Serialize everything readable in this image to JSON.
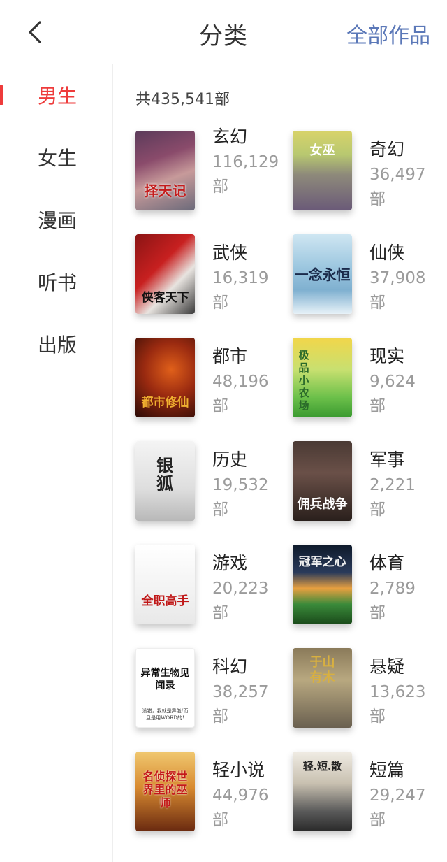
{
  "header": {
    "back_icon": "chevron-left-icon",
    "title": "分类",
    "all_works": "全部作品"
  },
  "sidebar": {
    "accent_color": "#ee3b3b",
    "items": [
      {
        "label": "男生",
        "active": true
      },
      {
        "label": "女生",
        "active": false
      },
      {
        "label": "漫画",
        "active": false
      },
      {
        "label": "听书",
        "active": false
      },
      {
        "label": "出版",
        "active": false
      }
    ]
  },
  "total": "共435,541部",
  "categories": [
    {
      "name": "玄幻",
      "count": "116,129",
      "unit": "部",
      "cover_title": "择天记"
    },
    {
      "name": "奇幻",
      "count": "36,497",
      "unit": "部",
      "cover_title": "女巫"
    },
    {
      "name": "武侠",
      "count": "16,319",
      "unit": "部",
      "cover_title": "侠客天下"
    },
    {
      "name": "仙侠",
      "count": "37,908",
      "unit": "部",
      "cover_title": "一念永恒"
    },
    {
      "name": "都市",
      "count": "48,196",
      "unit": "部",
      "cover_title": "都市修仙"
    },
    {
      "name": "现实",
      "count": "9,624",
      "unit": "部",
      "cover_title": "极品小农场"
    },
    {
      "name": "历史",
      "count": "19,532",
      "unit": "部",
      "cover_title": "银狐"
    },
    {
      "name": "军事",
      "count": "2,221",
      "unit": "部",
      "cover_title": "佣兵战争"
    },
    {
      "name": "游戏",
      "count": "20,223",
      "unit": "部",
      "cover_title": "全职高手"
    },
    {
      "name": "体育",
      "count": "2,789",
      "unit": "部",
      "cover_title": "冠军之心"
    },
    {
      "name": "科幻",
      "count": "38,257",
      "unit": "部",
      "cover_title": "异常生物见闻录",
      "cover_subtitle": "没错，我就是异能!而且是用WORD的!"
    },
    {
      "name": "悬疑",
      "count": "13,623",
      "unit": "部",
      "cover_title": "于山有木"
    },
    {
      "name": "轻小说",
      "count": "44,976",
      "unit": "部",
      "cover_title": "名侦探世界里的巫师"
    },
    {
      "name": "短篇",
      "count": "29,247",
      "unit": "部",
      "cover_title": "轻.短.散"
    }
  ]
}
